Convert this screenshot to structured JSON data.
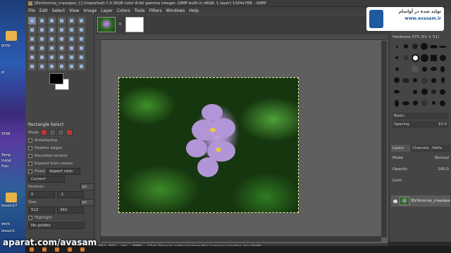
{
  "window": {
    "title": "[Eichhornia_crassipes_C] (imported)-7.0 (RGB color 8-bit gamma integer, GIMP built-in sRGB, 1 layer) 1024x768 – GIMP"
  },
  "menubar": [
    "File",
    "Edit",
    "Select",
    "View",
    "Image",
    "Layer",
    "Colors",
    "Tools",
    "Filters",
    "Windows",
    "Help"
  ],
  "desktop": {
    "labels": [
      "gimp",
      "pi",
      "STAR",
      "Temp",
      "Instal",
      "Posi",
      "lesson17",
      "work",
      "lesson1"
    ]
  },
  "tool_options": {
    "title": "Rectangle Select",
    "mode_label": "Mode",
    "antialias": "Antialiasing",
    "feather": "Feather edges",
    "rounded": "Rounded corners",
    "expand": "Expand from center",
    "fixed_label": "Fixed",
    "fixed_value": "Aspect ratio",
    "current": "Current",
    "position_label": "Position:",
    "position_unit": "px",
    "pos_x": "0",
    "pos_y": "-1",
    "size_label": "Size:",
    "size_unit": "px",
    "size_w": "512",
    "size_h": "342",
    "highlight": "Highlight",
    "guides": "No guides"
  },
  "statusbar": {
    "coords": "552, 392",
    "units": "px",
    "zoom": "50%",
    "message": "Click-Drag to subtract from the current selection (try Shift)"
  },
  "brushes": {
    "title": "Hardness 075 (51 × 51)",
    "basic": "Basic,",
    "spacing_label": "Spacing",
    "spacing_value": "10.0"
  },
  "layers": {
    "tabs": [
      "Layers",
      "Channels",
      "Paths"
    ],
    "mode_label": "Mode",
    "mode_value": "Normal",
    "opacity_label": "Opacity",
    "opacity_value": "100.0",
    "lock_label": "Lock:",
    "layer_name": "Eichhornia_crassipes_"
  },
  "watermark": {
    "line1": "تولید شده در آواسام",
    "line2": "www.avasam.ir"
  },
  "footer": {
    "aparat": "aparat.com/avasam"
  }
}
